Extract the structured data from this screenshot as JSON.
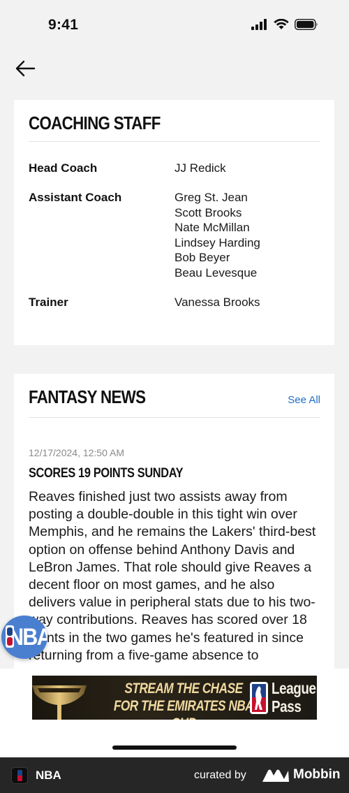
{
  "status_bar": {
    "time": "9:41"
  },
  "coaching_staff": {
    "title": "COACHING STAFF",
    "rows": [
      {
        "role": "Head Coach",
        "names": "JJ Redick"
      },
      {
        "role": "Assistant Coach",
        "names": "Greg St. Jean\nScott Brooks\nNate McMillan\nLindsey Harding\nBob Beyer\nBeau Levesque"
      },
      {
        "role": "Trainer",
        "names": "Vanessa Brooks"
      }
    ]
  },
  "fantasy_news": {
    "title": "FANTASY NEWS",
    "see_all": "See All",
    "date": "12/17/2024, 12:50 AM",
    "headline": "SCORES 19 POINTS SUNDAY",
    "body": "Reaves finished just two assists away from posting a double-double in this tight win over Memphis, and he remains the Lakers' third-best option on offense behind Anthony Davis and LeBron James. That role should give Reaves a decent floor on most games, and he also delivers value in peripheral stats due to his two-way contributions. Reaves has scored over 18 points in the two games he's featured in since returning from a five-game absence to"
  },
  "floating_button": {
    "label": "NBA"
  },
  "ad": {
    "line1": "STREAM THE CHASE",
    "line2": "FOR THE EMIRATES NBA CUP",
    "brand_line1": "League",
    "brand_line2": "Pass"
  },
  "footer": {
    "app_name": "NBA",
    "curated_by": "curated by",
    "brand": "Mobbin"
  },
  "colors": {
    "accent_link": "#1d6fc4",
    "nba_blue": "#1d428a",
    "nba_red": "#c8102e",
    "footer_bg": "#262626"
  }
}
